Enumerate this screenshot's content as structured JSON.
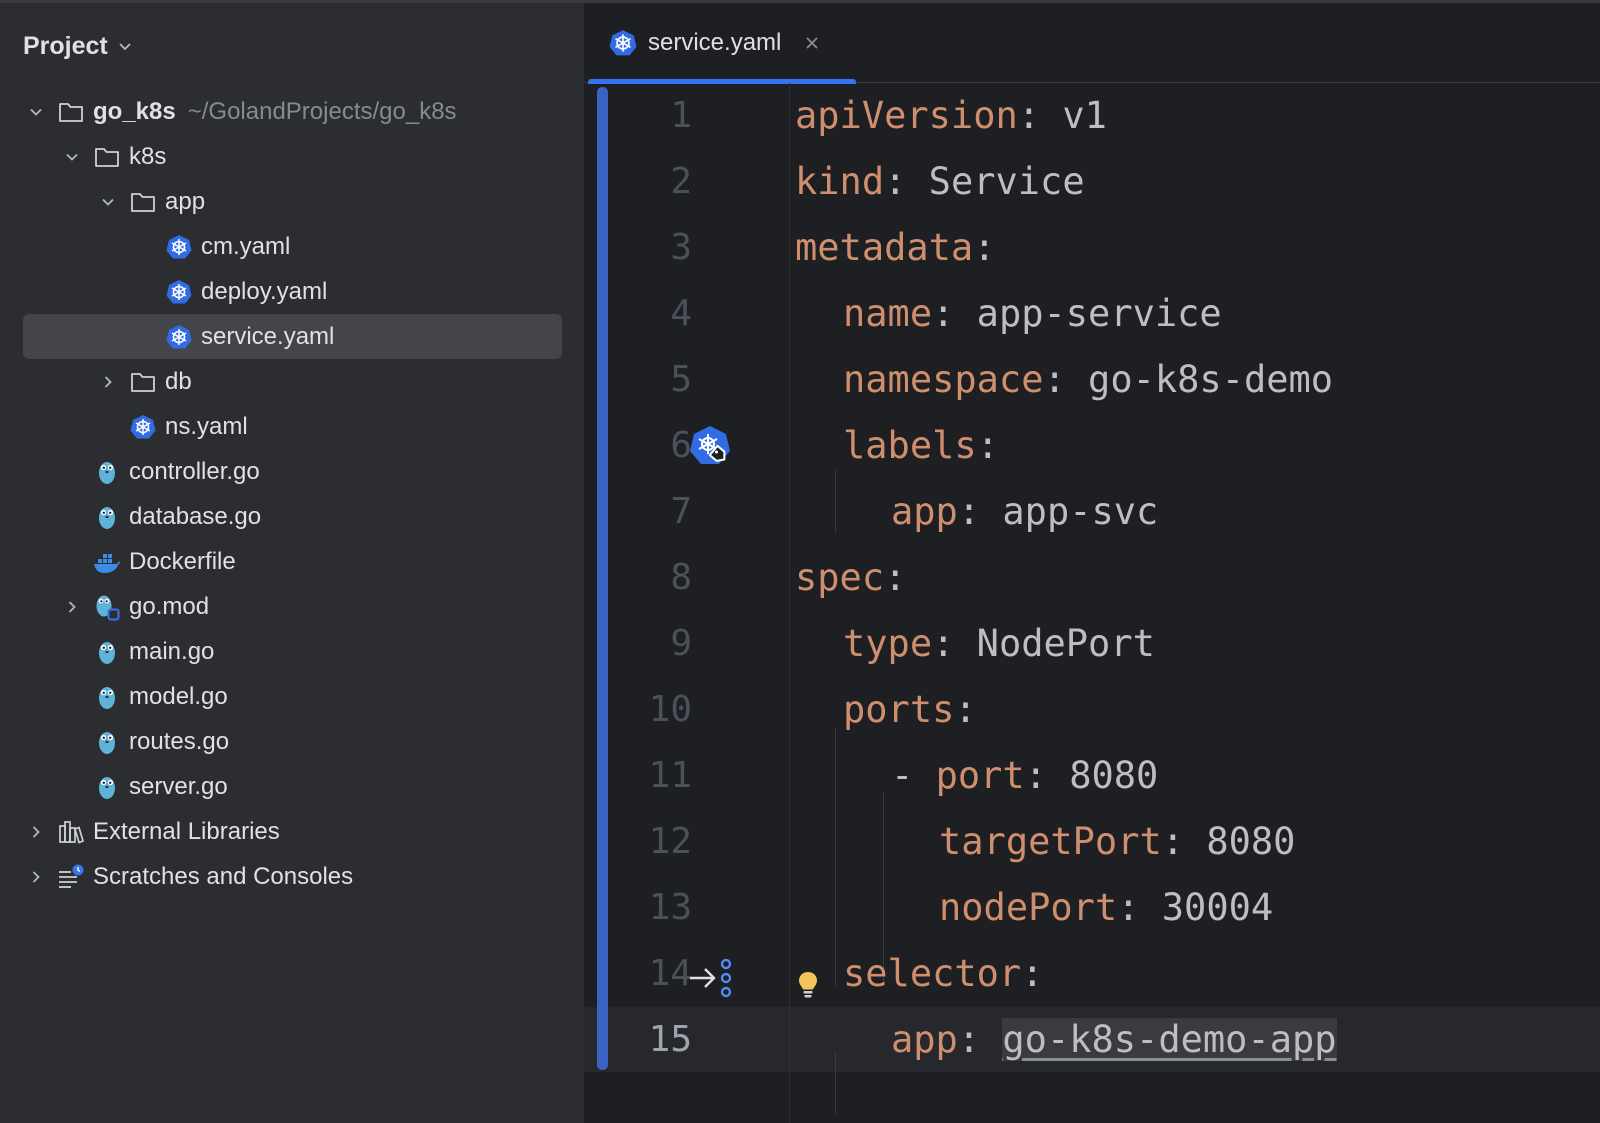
{
  "colors": {
    "accent": "#3574f0",
    "key": "#cf8e6d",
    "value": "#bcbec4",
    "panel_bg": "#2b2d30",
    "editor_bg": "#1e1f22",
    "k8s_blue": "#326ce5",
    "gopher_blue": "#5fb3d9",
    "bulb_yellow": "#f2c55c"
  },
  "project_panel": {
    "title": "Project",
    "tree": [
      {
        "label": "go_k8s",
        "path": "~/GolandProjects/go_k8s",
        "icon": "folder-icon",
        "expanded": true
      },
      {
        "label": "k8s",
        "icon": "folder-icon",
        "expanded": true
      },
      {
        "label": "app",
        "icon": "folder-icon",
        "expanded": true
      },
      {
        "label": "cm.yaml",
        "icon": "kubernetes-icon"
      },
      {
        "label": "deploy.yaml",
        "icon": "kubernetes-icon"
      },
      {
        "label": "service.yaml",
        "icon": "kubernetes-icon",
        "selected": true
      },
      {
        "label": "db",
        "icon": "folder-icon",
        "expanded": false
      },
      {
        "label": "ns.yaml",
        "icon": "kubernetes-icon"
      },
      {
        "label": "controller.go",
        "icon": "go-gopher-icon"
      },
      {
        "label": "database.go",
        "icon": "go-gopher-icon"
      },
      {
        "label": "Dockerfile",
        "icon": "docker-icon"
      },
      {
        "label": "go.mod",
        "icon": "go-mod-icon",
        "expanded": false
      },
      {
        "label": "main.go",
        "icon": "go-gopher-icon"
      },
      {
        "label": "model.go",
        "icon": "go-gopher-icon"
      },
      {
        "label": "routes.go",
        "icon": "go-gopher-icon"
      },
      {
        "label": "server.go",
        "icon": "go-gopher-icon"
      },
      {
        "label": "External Libraries",
        "icon": "library-icon",
        "expanded": false
      },
      {
        "label": "Scratches and Consoles",
        "icon": "scratches-icon",
        "expanded": false
      }
    ]
  },
  "editor": {
    "tab": {
      "label": "service.yaml",
      "icon": "kubernetes-icon"
    },
    "current_line": 15,
    "gutter_icons": {
      "line6": "kubernetes-label-icon",
      "line14": "selector-navigate-icon",
      "line14_hint": "lightbulb-icon"
    },
    "line_numbers": [
      "1",
      "2",
      "3",
      "4",
      "5",
      "6",
      "7",
      "8",
      "9",
      "10",
      "11",
      "12",
      "13",
      "14",
      "15"
    ],
    "lines": [
      {
        "key": "apiVersion",
        "sep": ": ",
        "value": "v1"
      },
      {
        "key": "kind",
        "sep": ": ",
        "value": "Service"
      },
      {
        "key": "metadata",
        "sep": ":",
        "value": ""
      },
      {
        "key": "name",
        "sep": ": ",
        "value": "app-service"
      },
      {
        "key": "namespace",
        "sep": ": ",
        "value": "go-k8s-demo"
      },
      {
        "key": "labels",
        "sep": ":",
        "value": ""
      },
      {
        "key": "app",
        "sep": ": ",
        "value": "app-svc"
      },
      {
        "key": "spec",
        "sep": ":",
        "value": ""
      },
      {
        "key": "type",
        "sep": ": ",
        "value": "NodePort"
      },
      {
        "key": "ports",
        "sep": ":",
        "value": ""
      },
      {
        "dash": "- ",
        "key": "port",
        "sep": ": ",
        "value": "8080"
      },
      {
        "key": "targetPort",
        "sep": ": ",
        "value": "8080"
      },
      {
        "key": "nodePort",
        "sep": ": ",
        "value": "30004"
      },
      {
        "key": "selector",
        "sep": ":",
        "value": ""
      },
      {
        "key": "app",
        "sep": ": ",
        "value": "go-k8s-demo-app"
      }
    ]
  }
}
